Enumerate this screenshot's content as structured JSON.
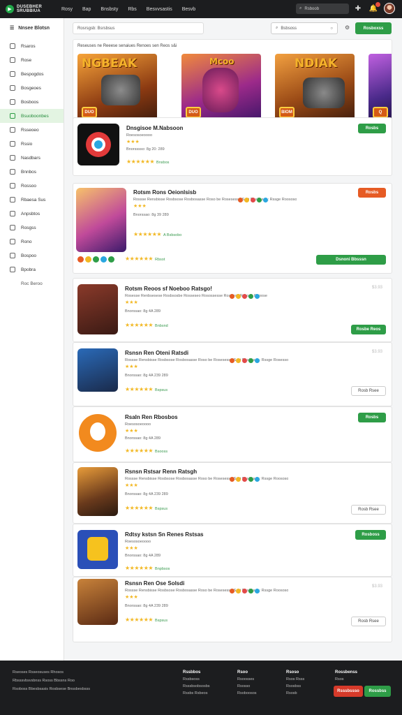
{
  "topbar": {
    "logo_line1": "DUSEBHER",
    "logo_line2": "SRUBBIUA",
    "nav": [
      "Rosy",
      "Bap",
      "Bnsbsty",
      "Rbs",
      "Besvvsastis",
      "Besvb"
    ],
    "search_placeholder": "Rsboob"
  },
  "sidebar": {
    "header": "Nnsee Blotsn",
    "items": [
      {
        "label": "Rsaros",
        "active": false
      },
      {
        "label": "Rose",
        "active": false
      },
      {
        "label": "Bespogdos",
        "active": false
      },
      {
        "label": "Bosgeoes",
        "active": false
      },
      {
        "label": "Bosboos",
        "active": false
      },
      {
        "label": "Bsuoboonbes",
        "active": true
      },
      {
        "label": "Rsseoeo",
        "active": false
      },
      {
        "label": "Rssio",
        "active": false
      },
      {
        "label": "Nasdbars",
        "active": false
      },
      {
        "label": "Bnnbos",
        "active": false
      },
      {
        "label": "Rossoo",
        "active": false
      },
      {
        "label": "Rbaesa Sus",
        "active": false
      },
      {
        "label": "Anpsbtos",
        "active": false
      },
      {
        "label": "Rosgss",
        "active": false
      },
      {
        "label": "Rono",
        "active": false
      },
      {
        "label": "Bospoo",
        "active": false
      },
      {
        "label": "Bpobra",
        "active": false
      }
    ],
    "sub_item": "Roc Beroo"
  },
  "main": {
    "filter_text": "Rosrsgsb: Bsrsbsus",
    "search_placeholder": "Bsbsoss",
    "primary_button": "Rosboxss",
    "featured_title": "Reseuses ne Reeese senaiues Renoes sen Reos s&i",
    "banners": [
      {
        "title": "NGBEAK",
        "emblem": "DUO",
        "bg": "#6b3a1c"
      },
      {
        "title": "Mcoo",
        "emblem": "DUO",
        "bg": "#7a2a8c"
      },
      {
        "title": "NDIAK",
        "emblem": "BIOM",
        "bg": "#8a4418"
      },
      {
        "title": "",
        "emblem": "Q",
        "bg": "#4a2a8a"
      }
    ]
  },
  "apps": [
    {
      "name": "Dnsgisoe M.Nabsoon",
      "sub": "Roesosoeoooo",
      "meta": "Bnorsssso: 8g 20: 289",
      "rating_label": "Bnsbos",
      "button": "Rosbs",
      "button_style": "green",
      "icon": "camera"
    },
    {
      "name": "Rotsm Rons Oeionlsisb",
      "sub": "Rossse Rensbisse Rosbsose Rosbosasse Roso be Rosesesse Sesi Rosbesoe: Rssge Roososo",
      "meta": "Bnorssao: 8g 39 289",
      "rating_label": "A Bsbsobo",
      "dots_label": "Rbsot",
      "button": "Rosbs",
      "button_style": "orange",
      "second_button": "Dsnoni Bbsssn",
      "icon": "warrior"
    },
    {
      "name": "Rotsm Reoos sf Noeboo Ratsgo!",
      "sub": "Rosesse Renbsesese Rosbsosbe Rosseseo Rosossesse Rosbesb Rssone Reoose",
      "meta": "Bnorssao: 8g 4A 289",
      "rating_label": "Bnbsnd",
      "button": "Rosbe Reos",
      "button_style": "green",
      "price": "$3.93",
      "icon": "girl"
    },
    {
      "name": "Rsnsn Ren Oteni Ratsdi",
      "sub": "Rossse Rensbisse Rosbsose Rosbosasse Roso be Rosesesse Sesi Rosbesoe: Rssge Rosesso",
      "meta": "Bnorssao: 8g 4A 239 289",
      "rating_label": "Bspsus",
      "button": "Rosb Rsee",
      "button_style": "outline",
      "price": "$3.93",
      "icon": "robot"
    },
    {
      "name": "Rsaln Ren Rbosbos",
      "sub": "Roesosoeoooo",
      "meta": "Bnorssao: 8g 4A 289",
      "rating_label": "Bsooss",
      "button": "Rosbs",
      "button_style": "green",
      "icon": "orange"
    },
    {
      "name": "Rsnsn Rstsar Renn Ratsgh",
      "sub": "Rossse Rensbisse Rosbsose Rosbosasse Roso be Rosesesse Sesi Rosbesoe: Rssge Roososo",
      "meta": "Bnorssao: 8g 4A 239 289",
      "rating_label": "Bspsus",
      "button": "Rosb Rsee",
      "button_style": "outline",
      "icon": "mech"
    },
    {
      "name": "Rdtsy kstsn Sn Renes Rstsas",
      "sub": "Roesosoeoooo",
      "meta": "Bnorssao: 8g 4A 289",
      "rating_label": "Bnpbsos",
      "button": "Rosboss",
      "button_style": "green",
      "icon": "blue"
    },
    {
      "name": "Rsnsn Ren Ose Solsdi",
      "sub": "Rossse Rensbisse Rosbsose Rosbosasse Roso be Rosesesse Sesi Rosbesoe: Rssge Roososo",
      "meta": "Bnorssao: 8g 4A 239 289",
      "rating_label": "Bspsus",
      "button": "Rosb Rsee",
      "button_style": "outline",
      "price": "$3.93",
      "icon": "adventurer"
    }
  ],
  "footer": {
    "col1": [
      "Rseoses  Rsseosuses  Rhosos",
      "Rbsssvbsvsbnss Rsoss Bbssns Roo",
      "Rsoboss Bbesbsasis Rosbsese Bnssbesbsss"
    ],
    "col2_title": "Rssbbos",
    "col2": [
      "Rssbsoss",
      "Rsssbsobsosbs",
      "Rssbs Rsbeos"
    ],
    "col3_title": "Rsoo",
    "col3": [
      "Rsoosses",
      "Rsosso",
      "Rsoboosos"
    ],
    "col4_title": "Rsoso",
    "col4": [
      "Rsos Rsss",
      "Rsosbss",
      "Rsosb"
    ],
    "col5_title": "Rossbenss",
    "col5": [
      "Rsos"
    ],
    "btn_red": "Rsssbssso",
    "btn_green": "Rossbss"
  }
}
